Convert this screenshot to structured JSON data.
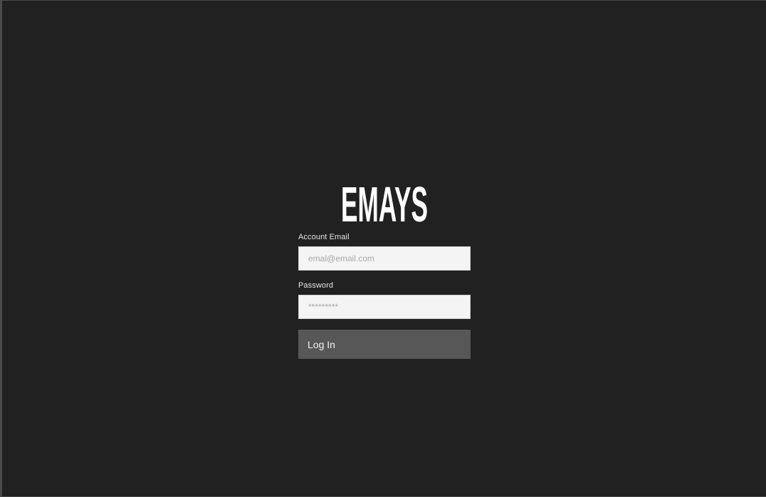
{
  "app": {
    "logo_text": "EMAYS"
  },
  "login_form": {
    "email_label": "Account Email",
    "email_placeholder": "emal@email.com",
    "password_label": "Password",
    "password_placeholder": "*********",
    "submit_label": "Log In"
  },
  "colors": {
    "background": "#212121",
    "input_background": "#f4f4f4",
    "button_background": "#575757",
    "text": "#ffffff"
  }
}
